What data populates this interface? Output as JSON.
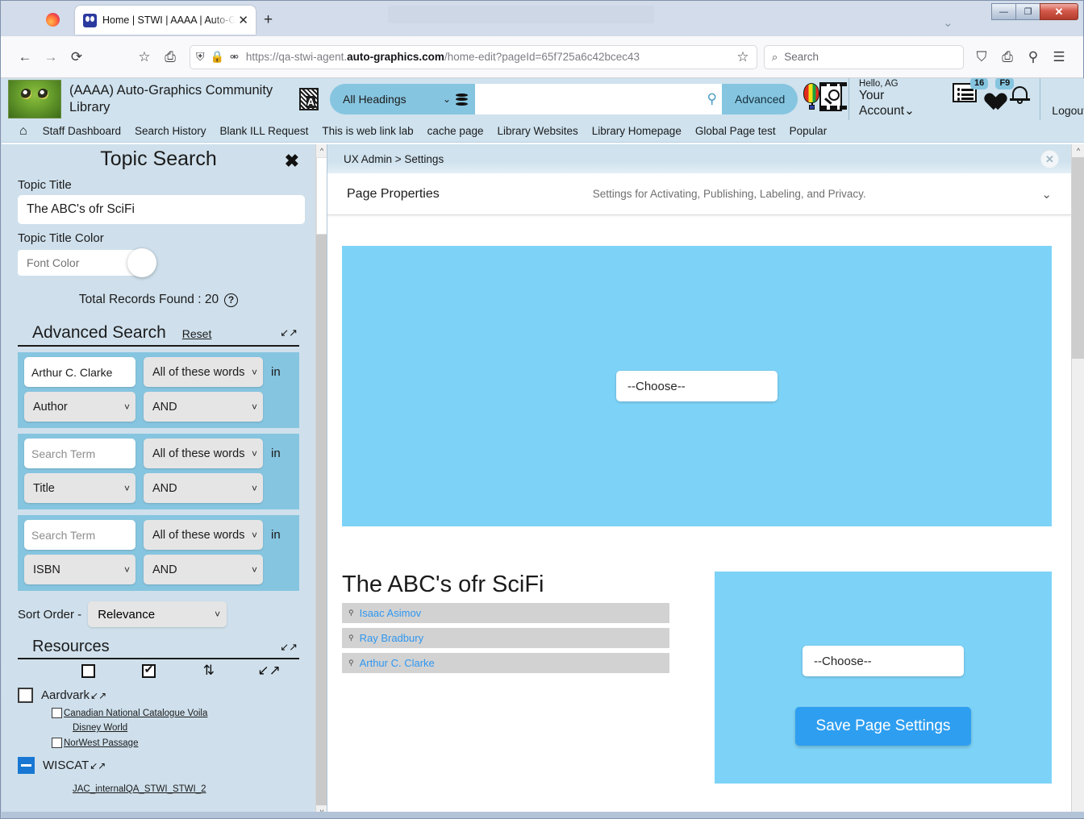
{
  "browser": {
    "tab_title": "Home | STWI | AAAA | Auto-Gra",
    "tab_close_label": "✕",
    "new_tab_label": "+",
    "back_icon": "←",
    "forward_icon": "→",
    "reload_icon": "⟳",
    "bookmark_icon": "☆",
    "save_to_pocket_icon": "⎙",
    "shield_icon": "⛨",
    "lock_icon": "🔒",
    "permissions_icon": "⚯",
    "url_prefix": "https://qa-stwi-agent.",
    "url_domain": "auto-graphics.com",
    "url_suffix": "/home-edit?pageId=65f725a6c42bcec43",
    "search_placeholder": "Search",
    "search_icon": "⌕",
    "account_icon": "⛉",
    "print_icon": "⎙",
    "extensions_icon": "⚲",
    "menu_icon": "☰",
    "window_minimize": "—",
    "window_maximize": "❐",
    "window_close": "✕",
    "tabstrip_chevron": "⌄"
  },
  "app_header": {
    "library_name": "(AAAA) Auto-Graphics Community Library",
    "abc_icon_letter": "A",
    "heading_select_value": "All Headings",
    "chevron": "⌄",
    "search_value": "",
    "advanced_label": "Advanced",
    "list_badge": "16",
    "heart_badge": "F9",
    "hello_text": "Hello, AG",
    "your_account_label": "Your Account",
    "your_account_chevron": "⌄",
    "logout_label": "Logout"
  },
  "nav_links": {
    "home_icon": "⌂",
    "items": [
      "Staff Dashboard",
      "Search History",
      "Blank ILL Request",
      "This is web link lab",
      "cache page",
      "Library Websites",
      "Library Homepage",
      "Global Page test",
      "Popular"
    ]
  },
  "topic_search": {
    "panel_title": "Topic Search",
    "close_label": "✖",
    "topic_title_label": "Topic Title",
    "topic_title_value": "The ABC's ofr SciFi",
    "topic_title_color_label": "Topic Title Color",
    "font_color_placeholder": "Font Color",
    "total_records_label": "Total Records Found : 20",
    "help_icon": "?",
    "advanced_search_title": "Advanced Search",
    "reset_label": "Reset",
    "collapse_icon": "↙",
    "rows": [
      {
        "term_value": "Arthur C. Clarke",
        "term_placeholder": "Search Term",
        "match_value": "All of these words",
        "field_value": "Author",
        "boolean_value": "AND",
        "in_label": "in"
      },
      {
        "term_value": "",
        "term_placeholder": "Search Term",
        "match_value": "All of these words",
        "field_value": "Title",
        "boolean_value": "AND",
        "in_label": "in"
      },
      {
        "term_value": "",
        "term_placeholder": "Search Term",
        "match_value": "All of these words",
        "field_value": "ISBN",
        "boolean_value": "AND",
        "in_label": "in"
      }
    ],
    "sort_order_label": "Sort Order -",
    "sort_order_value": "Relevance",
    "resources_title": "Resources",
    "resources_toolbar": [
      "uncheck-all-icon",
      "check-all-icon",
      "toggle-icon",
      "collapse-icon"
    ],
    "resource_items": [
      {
        "label": "Aardvark",
        "type": "checkbox",
        "checked": false,
        "expand_icon": "↗"
      },
      {
        "label": "Canadian National Catalogue Voila",
        "type": "sub-checkbox",
        "checked": false
      },
      {
        "label": "Disney World",
        "type": "sub-link"
      },
      {
        "label": "NorWest Passage",
        "type": "sub-checkbox",
        "checked": false
      },
      {
        "label": "WISCAT",
        "type": "minus",
        "expand_icon": "↗"
      },
      {
        "label": "JAC_internalQA_STWI_STWI_2",
        "type": "sub-link"
      }
    ]
  },
  "settings": {
    "breadcrumb": "UX Admin > Settings",
    "close_label": "✕",
    "page_properties_title": "Page Properties",
    "page_properties_subtitle": "Settings for Activating, Publishing, Labeling, and Privacy.",
    "chevron": "⌄",
    "choose_top_value": "--Choose--",
    "choose_bottom_value": "--Choose--",
    "save_button_label": "Save Page Settings",
    "result_title": "The ABC's ofr SciFi",
    "result_rows": [
      {
        "icon": "search-icon",
        "label": "Isaac Asimov"
      },
      {
        "icon": "search-icon",
        "label": "Ray Bradbury"
      },
      {
        "icon": "search-icon",
        "label": "Arthur C. Clarke"
      }
    ]
  },
  "colors": {
    "header_blue": "#cfe2ee",
    "accent_blue": "#86c5e0",
    "panel_blue": "#7dd3f7",
    "save_button_blue": "#2e9ef0",
    "link_blue": "#2f97f0",
    "left_panel_bg": "#cfe0ec"
  }
}
